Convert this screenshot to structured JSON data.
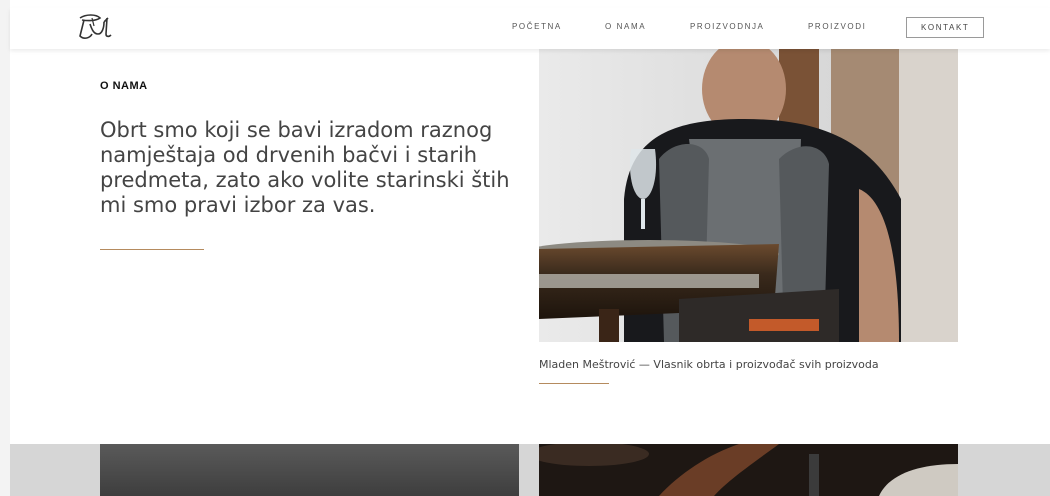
{
  "header": {
    "logo_alt": "logo",
    "nav": [
      {
        "label": "POČETNA"
      },
      {
        "label": "O NAMA"
      },
      {
        "label": "PROIZVODNJA"
      },
      {
        "label": "PROIZVODI"
      },
      {
        "label": "KONTAKT"
      }
    ]
  },
  "about": {
    "section_label": "O NAMA",
    "text": "Obrt smo koji se bavi izradom raznog namještaja od drvenih bačvi i starih predmeta, zato ako volite starinski štih mi smo pravi izbor za vas.",
    "caption": "Mladen Meštrović — Vlasnik obrta i proizvođač svih proizvoda"
  },
  "colors": {
    "accent": "#b58b5e",
    "text": "#444444",
    "background": "#ffffff"
  }
}
